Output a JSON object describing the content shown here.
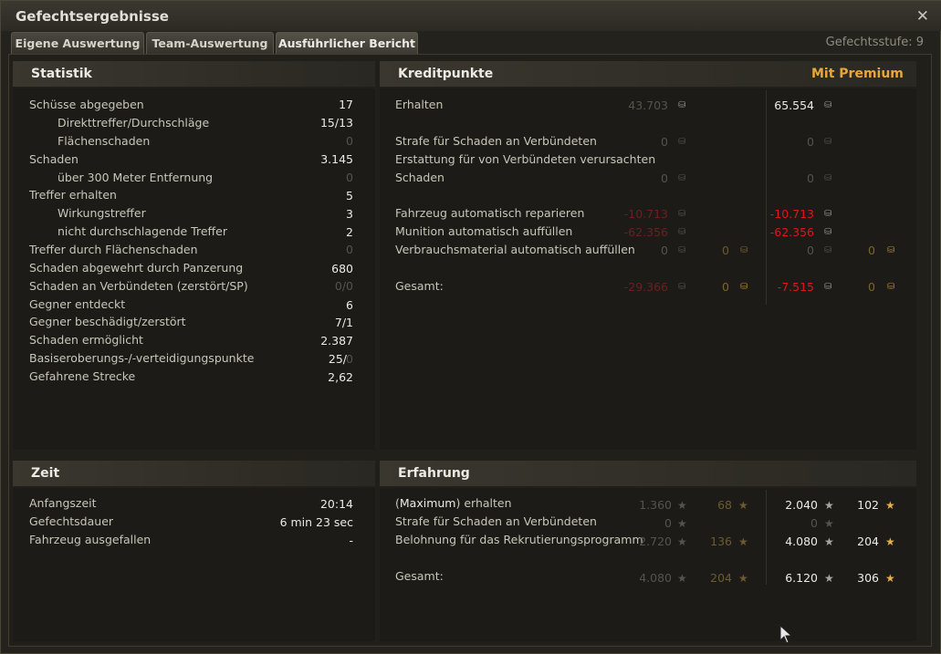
{
  "window": {
    "title": "Gefechtsergebnisse",
    "level": "Gefechtsstufe: 9"
  },
  "tabs": [
    {
      "label": "Eigene Auswertung"
    },
    {
      "label": "Team-Auswertung"
    },
    {
      "label": "Ausführlicher Bericht"
    }
  ],
  "statistik": {
    "title": "Statistik",
    "rows": [
      {
        "label": "Schüsse abgegeben",
        "value": "17"
      },
      {
        "label": "Direkttreffer/Durchschläge",
        "value": "15/13"
      },
      {
        "label": "Flächenschaden",
        "value": "0"
      },
      {
        "label": "Schaden",
        "value": "3.145"
      },
      {
        "label": "über 300 Meter Entfernung",
        "value": "0"
      },
      {
        "label": "Treffer erhalten",
        "value": "5"
      },
      {
        "label": "Wirkungstreffer",
        "value": "3"
      },
      {
        "label": "nicht durchschlagende Treffer",
        "value": "2"
      },
      {
        "label": "Treffer durch Flächenschaden",
        "value": "0"
      },
      {
        "label": "Schaden abgewehrt durch Panzerung",
        "value": "680"
      },
      {
        "label": "Schaden an Verbündeten (zerstört/SP)",
        "value": "0/0"
      },
      {
        "label": "Gegner entdeckt",
        "value": "6"
      },
      {
        "label": "Gegner beschädigt/zerstört",
        "value": "7/1"
      },
      {
        "label": "Schaden ermöglicht",
        "value": "2.387"
      },
      {
        "label": "Basiseroberungs-/-verteidigungspunkte",
        "value_a": "25/",
        "value_b": "0"
      },
      {
        "label": "Gefahrene Strecke",
        "value": "2,62"
      }
    ]
  },
  "kredit": {
    "title": "Kreditpunkte",
    "premium": "Mit Premium",
    "rows": [
      {
        "label": "Erhalten",
        "basic": "43.703",
        "premium": "65.554"
      },
      {
        "label": "Strafe für Schaden an Verbündeten",
        "basic": "0",
        "premium": "0"
      },
      {
        "label": "Erstattung für von Verbündeten verursachten",
        "label2": "Schaden",
        "basic": "0",
        "premium": "0"
      },
      {
        "label": "Fahrzeug automatisch reparieren",
        "basic": "-10.713",
        "premium": "-10.713"
      },
      {
        "label": "Munition automatisch auffüllen",
        "basic": "-62.356",
        "premium": "-62.356"
      },
      {
        "label": "Verbrauchsmaterial automatisch auffüllen",
        "basic": "0",
        "basic_gold": "0",
        "premium": "0",
        "premium_gold": "0"
      },
      {
        "label": "Gesamt:",
        "basic": "-29.366",
        "basic_gold": "0",
        "premium": "-7.515",
        "premium_gold": "0"
      }
    ]
  },
  "zeit": {
    "title": "Zeit",
    "rows": [
      {
        "label": "Anfangszeit",
        "value": "20:14"
      },
      {
        "label": "Gefechtsdauer",
        "value": "6 min 23 sec"
      },
      {
        "label": "Fahrzeug ausgefallen",
        "value": "-"
      }
    ]
  },
  "erfahrung": {
    "title": "Erfahrung",
    "rows": [
      {
        "label_b": "Maximum",
        "label_pre": "(",
        "label_post": ") erhalten",
        "basic": "1.360",
        "basic_free": "68",
        "premium": "2.040",
        "premium_free": "102"
      },
      {
        "label": "Strafe für Schaden an Verbündeten",
        "basic": "0",
        "premium": "0"
      },
      {
        "label": "Belohnung für das Rekrutierungsprogramm",
        "basic": "2.720",
        "basic_free": "136",
        "premium": "4.080",
        "premium_free": "204"
      },
      {
        "label": "Gesamt:",
        "basic": "4.080",
        "basic_free": "204",
        "premium": "6.120",
        "premium_free": "306"
      }
    ]
  },
  "icons": {
    "credit": "credit-coin-icon",
    "gold": "gold-coin-icon",
    "xp": "star-icon",
    "close": "close-icon"
  },
  "colors": {
    "premium": "#e8a73a",
    "negative": "#e01515",
    "text": "#c8c6b8"
  }
}
